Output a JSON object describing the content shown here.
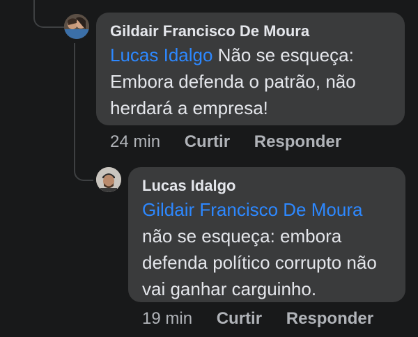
{
  "comments": [
    {
      "author": "Gildair Francisco De Moura",
      "mention": "Lucas Idalgo",
      "text": " Não se esqueça: Embora defenda o patrão, não herdará a empresa!",
      "time": "24 min",
      "like_label": "Curtir",
      "reply_label": "Responder"
    },
    {
      "author": "Lucas Idalgo",
      "mention": "Gildair Francisco De Moura",
      "text": "não se esqueça: embora defenda político corrupto não vai ganhar carguinho.",
      "time": "19 min",
      "like_label": "Curtir",
      "reply_label": "Responder"
    }
  ]
}
